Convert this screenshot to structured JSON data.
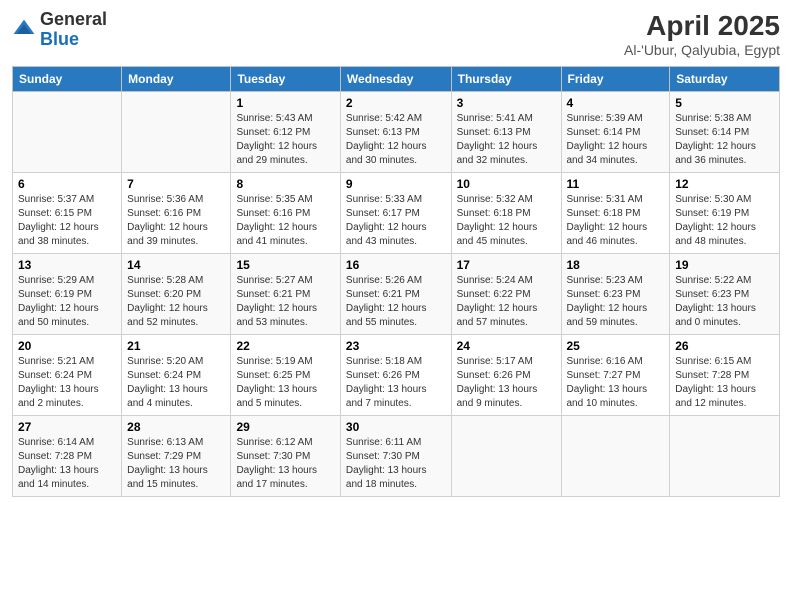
{
  "header": {
    "logo_line1": "General",
    "logo_line2": "Blue",
    "main_title": "April 2025",
    "subtitle": "Al-'Ubur, Qalyubia, Egypt"
  },
  "calendar": {
    "days_of_week": [
      "Sunday",
      "Monday",
      "Tuesday",
      "Wednesday",
      "Thursday",
      "Friday",
      "Saturday"
    ],
    "weeks": [
      [
        {
          "day": "",
          "info": ""
        },
        {
          "day": "",
          "info": ""
        },
        {
          "day": "1",
          "info": "Sunrise: 5:43 AM\nSunset: 6:12 PM\nDaylight: 12 hours\nand 29 minutes."
        },
        {
          "day": "2",
          "info": "Sunrise: 5:42 AM\nSunset: 6:13 PM\nDaylight: 12 hours\nand 30 minutes."
        },
        {
          "day": "3",
          "info": "Sunrise: 5:41 AM\nSunset: 6:13 PM\nDaylight: 12 hours\nand 32 minutes."
        },
        {
          "day": "4",
          "info": "Sunrise: 5:39 AM\nSunset: 6:14 PM\nDaylight: 12 hours\nand 34 minutes."
        },
        {
          "day": "5",
          "info": "Sunrise: 5:38 AM\nSunset: 6:14 PM\nDaylight: 12 hours\nand 36 minutes."
        }
      ],
      [
        {
          "day": "6",
          "info": "Sunrise: 5:37 AM\nSunset: 6:15 PM\nDaylight: 12 hours\nand 38 minutes."
        },
        {
          "day": "7",
          "info": "Sunrise: 5:36 AM\nSunset: 6:16 PM\nDaylight: 12 hours\nand 39 minutes."
        },
        {
          "day": "8",
          "info": "Sunrise: 5:35 AM\nSunset: 6:16 PM\nDaylight: 12 hours\nand 41 minutes."
        },
        {
          "day": "9",
          "info": "Sunrise: 5:33 AM\nSunset: 6:17 PM\nDaylight: 12 hours\nand 43 minutes."
        },
        {
          "day": "10",
          "info": "Sunrise: 5:32 AM\nSunset: 6:18 PM\nDaylight: 12 hours\nand 45 minutes."
        },
        {
          "day": "11",
          "info": "Sunrise: 5:31 AM\nSunset: 6:18 PM\nDaylight: 12 hours\nand 46 minutes."
        },
        {
          "day": "12",
          "info": "Sunrise: 5:30 AM\nSunset: 6:19 PM\nDaylight: 12 hours\nand 48 minutes."
        }
      ],
      [
        {
          "day": "13",
          "info": "Sunrise: 5:29 AM\nSunset: 6:19 PM\nDaylight: 12 hours\nand 50 minutes."
        },
        {
          "day": "14",
          "info": "Sunrise: 5:28 AM\nSunset: 6:20 PM\nDaylight: 12 hours\nand 52 minutes."
        },
        {
          "day": "15",
          "info": "Sunrise: 5:27 AM\nSunset: 6:21 PM\nDaylight: 12 hours\nand 53 minutes."
        },
        {
          "day": "16",
          "info": "Sunrise: 5:26 AM\nSunset: 6:21 PM\nDaylight: 12 hours\nand 55 minutes."
        },
        {
          "day": "17",
          "info": "Sunrise: 5:24 AM\nSunset: 6:22 PM\nDaylight: 12 hours\nand 57 minutes."
        },
        {
          "day": "18",
          "info": "Sunrise: 5:23 AM\nSunset: 6:23 PM\nDaylight: 12 hours\nand 59 minutes."
        },
        {
          "day": "19",
          "info": "Sunrise: 5:22 AM\nSunset: 6:23 PM\nDaylight: 13 hours\nand 0 minutes."
        }
      ],
      [
        {
          "day": "20",
          "info": "Sunrise: 5:21 AM\nSunset: 6:24 PM\nDaylight: 13 hours\nand 2 minutes."
        },
        {
          "day": "21",
          "info": "Sunrise: 5:20 AM\nSunset: 6:24 PM\nDaylight: 13 hours\nand 4 minutes."
        },
        {
          "day": "22",
          "info": "Sunrise: 5:19 AM\nSunset: 6:25 PM\nDaylight: 13 hours\nand 5 minutes."
        },
        {
          "day": "23",
          "info": "Sunrise: 5:18 AM\nSunset: 6:26 PM\nDaylight: 13 hours\nand 7 minutes."
        },
        {
          "day": "24",
          "info": "Sunrise: 5:17 AM\nSunset: 6:26 PM\nDaylight: 13 hours\nand 9 minutes."
        },
        {
          "day": "25",
          "info": "Sunrise: 6:16 AM\nSunset: 7:27 PM\nDaylight: 13 hours\nand 10 minutes."
        },
        {
          "day": "26",
          "info": "Sunrise: 6:15 AM\nSunset: 7:28 PM\nDaylight: 13 hours\nand 12 minutes."
        }
      ],
      [
        {
          "day": "27",
          "info": "Sunrise: 6:14 AM\nSunset: 7:28 PM\nDaylight: 13 hours\nand 14 minutes."
        },
        {
          "day": "28",
          "info": "Sunrise: 6:13 AM\nSunset: 7:29 PM\nDaylight: 13 hours\nand 15 minutes."
        },
        {
          "day": "29",
          "info": "Sunrise: 6:12 AM\nSunset: 7:30 PM\nDaylight: 13 hours\nand 17 minutes."
        },
        {
          "day": "30",
          "info": "Sunrise: 6:11 AM\nSunset: 7:30 PM\nDaylight: 13 hours\nand 18 minutes."
        },
        {
          "day": "",
          "info": ""
        },
        {
          "day": "",
          "info": ""
        },
        {
          "day": "",
          "info": ""
        }
      ]
    ]
  }
}
